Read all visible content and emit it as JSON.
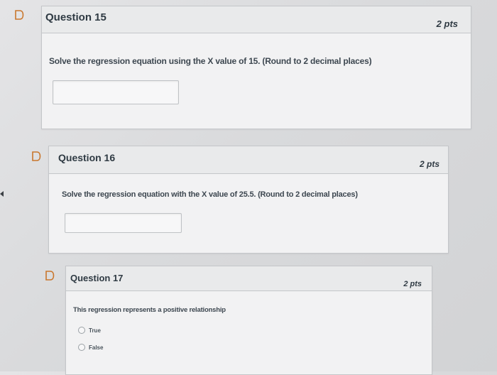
{
  "questions": [
    {
      "title": "Question 15",
      "points": "2 pts",
      "text": "Solve the regression equation using the X value of 15. (Round to 2 decimal places)",
      "answer": ""
    },
    {
      "title": "Question 16",
      "points": "2 pts",
      "text": "Solve the regression equation with the X value of 25.5. (Round to 2 decimal places)",
      "answer": ""
    },
    {
      "title": "Question 17",
      "points": "2 pts",
      "text": "This regression represents a positive relationship",
      "options": [
        "True",
        "False"
      ]
    }
  ],
  "icons": {
    "bookmark": "bookmark-icon",
    "accent": "#c9762c"
  }
}
